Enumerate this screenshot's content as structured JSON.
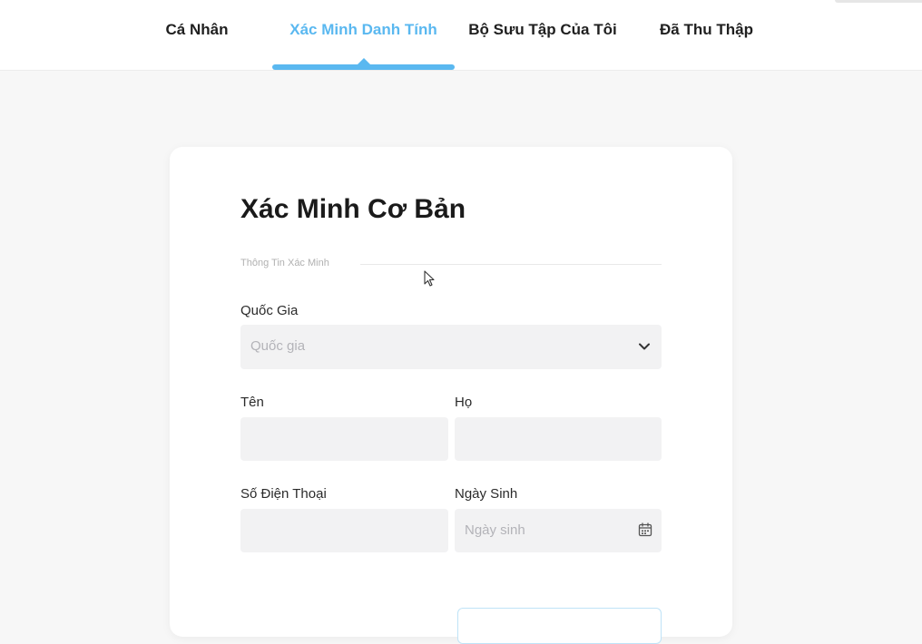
{
  "nav": {
    "tabs": [
      {
        "label": "Cá Nhân"
      },
      {
        "label": "Xác Minh Danh Tính",
        "active": true
      },
      {
        "label": "Bộ Sưu Tập Của Tôi"
      },
      {
        "label": "Đã Thu Thập"
      }
    ]
  },
  "form": {
    "title": "Xác Minh Cơ Bản",
    "section": "Thông Tin Xác Minh",
    "country": {
      "label": "Quốc Gia",
      "placeholder": "Quốc gia"
    },
    "first_name": {
      "label": "Tên"
    },
    "last_name": {
      "label": "Họ"
    },
    "phone": {
      "label": "Số Điện Thoại"
    },
    "birthday": {
      "label": "Ngày Sinh",
      "placeholder": "Ngày sinh"
    }
  },
  "colors": {
    "accent": "#5ab8f0",
    "field_bg": "#f2f2f3",
    "page_bg": "#f7f7f7"
  },
  "icons": [
    "chevron-down-icon",
    "calendar-icon",
    "mouse-cursor-icon"
  ]
}
